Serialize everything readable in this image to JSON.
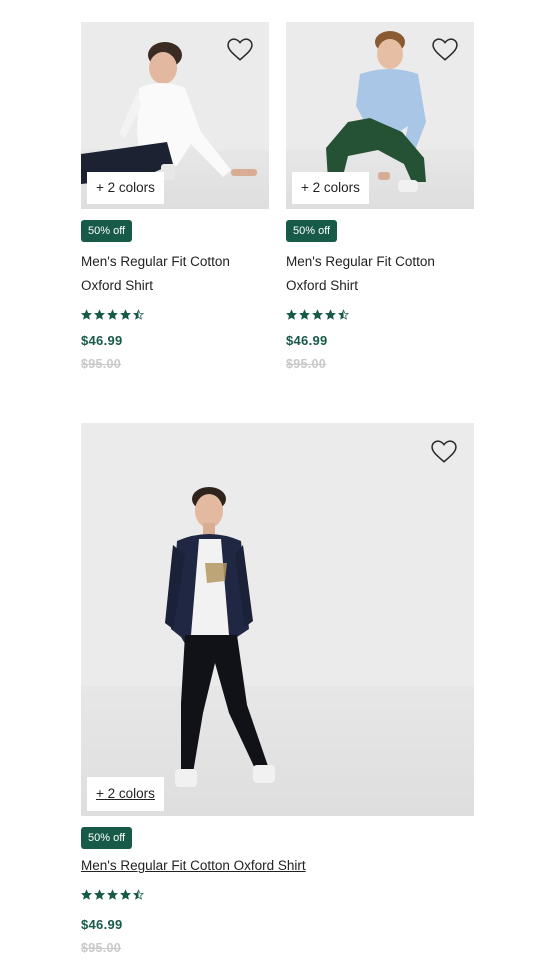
{
  "products": [
    {
      "colors_label": "+ 2 colors",
      "badge": "50% off",
      "title_line1": "Men's Regular Fit Cotton",
      "title_line2": "Oxford Shirt",
      "rating": 4.5,
      "price": "$46.99",
      "original_price": "$95.00"
    },
    {
      "colors_label": "+ 2 colors",
      "badge": "50% off",
      "title_line1": "Men's Regular Fit Cotton",
      "title_line2": "Oxford Shirt",
      "rating": 4.5,
      "price": "$46.99",
      "original_price": "$95.00"
    },
    {
      "colors_label": "+ 2 colors",
      "badge": "50% off",
      "title": "Men's Regular Fit Cotton Oxford Shirt",
      "rating": 4.5,
      "price": "$46.99",
      "original_price": "$95.00"
    }
  ],
  "icons": {
    "wishlist": "heart-outline-icon",
    "rating": "star-icon"
  },
  "colors": {
    "accent": "#175a47",
    "strikethrough_price": "#c9c9c9",
    "photo_background": "#ebebeb"
  }
}
